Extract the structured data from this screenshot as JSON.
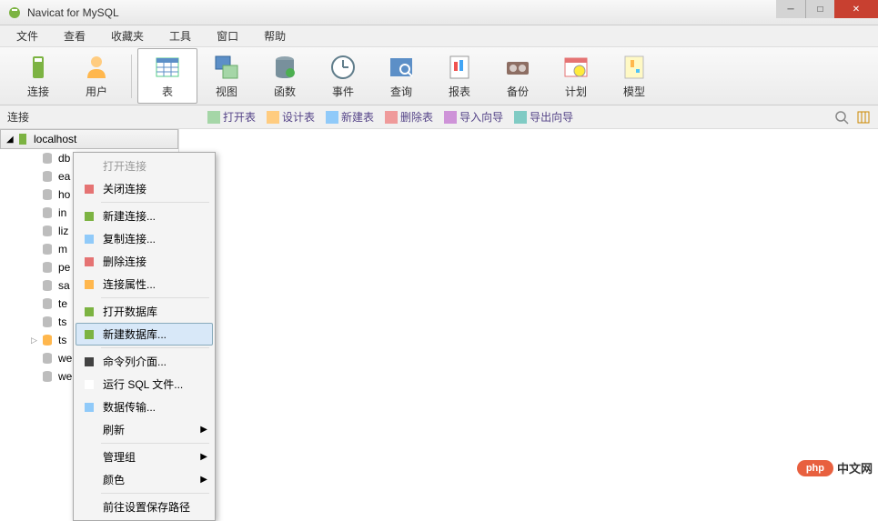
{
  "title": "Navicat for MySQL",
  "menu": [
    "文件",
    "查看",
    "收藏夹",
    "工具",
    "窗口",
    "帮助"
  ],
  "toolbar": [
    {
      "label": "连接",
      "icon": "connection"
    },
    {
      "label": "用户",
      "icon": "user"
    },
    {
      "label": "表",
      "icon": "table",
      "selected": true
    },
    {
      "label": "视图",
      "icon": "view"
    },
    {
      "label": "函数",
      "icon": "function"
    },
    {
      "label": "事件",
      "icon": "event"
    },
    {
      "label": "查询",
      "icon": "query"
    },
    {
      "label": "报表",
      "icon": "report"
    },
    {
      "label": "备份",
      "icon": "backup"
    },
    {
      "label": "计划",
      "icon": "schedule"
    },
    {
      "label": "模型",
      "icon": "model"
    }
  ],
  "subbar": {
    "label": "连接",
    "actions": [
      "打开表",
      "设计表",
      "新建表",
      "删除表",
      "导入向导",
      "导出向导"
    ]
  },
  "tree": {
    "conn": "localhost",
    "items": [
      "db",
      "ea",
      "ho",
      "in",
      "liz",
      "m",
      "pe",
      "sa",
      "te",
      "ts",
      "ts",
      "we",
      "we"
    ]
  },
  "context_menu": [
    {
      "label": "打开连接",
      "disabled": true
    },
    {
      "label": "关闭连接",
      "icon": "close-conn"
    },
    {
      "sep": true
    },
    {
      "label": "新建连接...",
      "icon": "new-conn"
    },
    {
      "label": "复制连接...",
      "icon": "dup-conn"
    },
    {
      "label": "删除连接",
      "icon": "del-conn"
    },
    {
      "label": "连接属性...",
      "icon": "props"
    },
    {
      "sep": true
    },
    {
      "label": "打开数据库",
      "icon": "open-db"
    },
    {
      "label": "新建数据库...",
      "icon": "new-db",
      "highlight": true
    },
    {
      "sep": true
    },
    {
      "label": "命令列介面...",
      "icon": "cli"
    },
    {
      "label": "运行 SQL 文件...",
      "icon": "run-sql"
    },
    {
      "label": "数据传输...",
      "icon": "transfer"
    },
    {
      "label": "刷新",
      "submenu": true
    },
    {
      "sep": true
    },
    {
      "label": "管理组",
      "submenu": true
    },
    {
      "label": "颜色",
      "submenu": true
    },
    {
      "sep": true
    },
    {
      "label": "前往设置保存路径"
    }
  ],
  "watermark": {
    "badge": "php",
    "text": "中文网"
  }
}
